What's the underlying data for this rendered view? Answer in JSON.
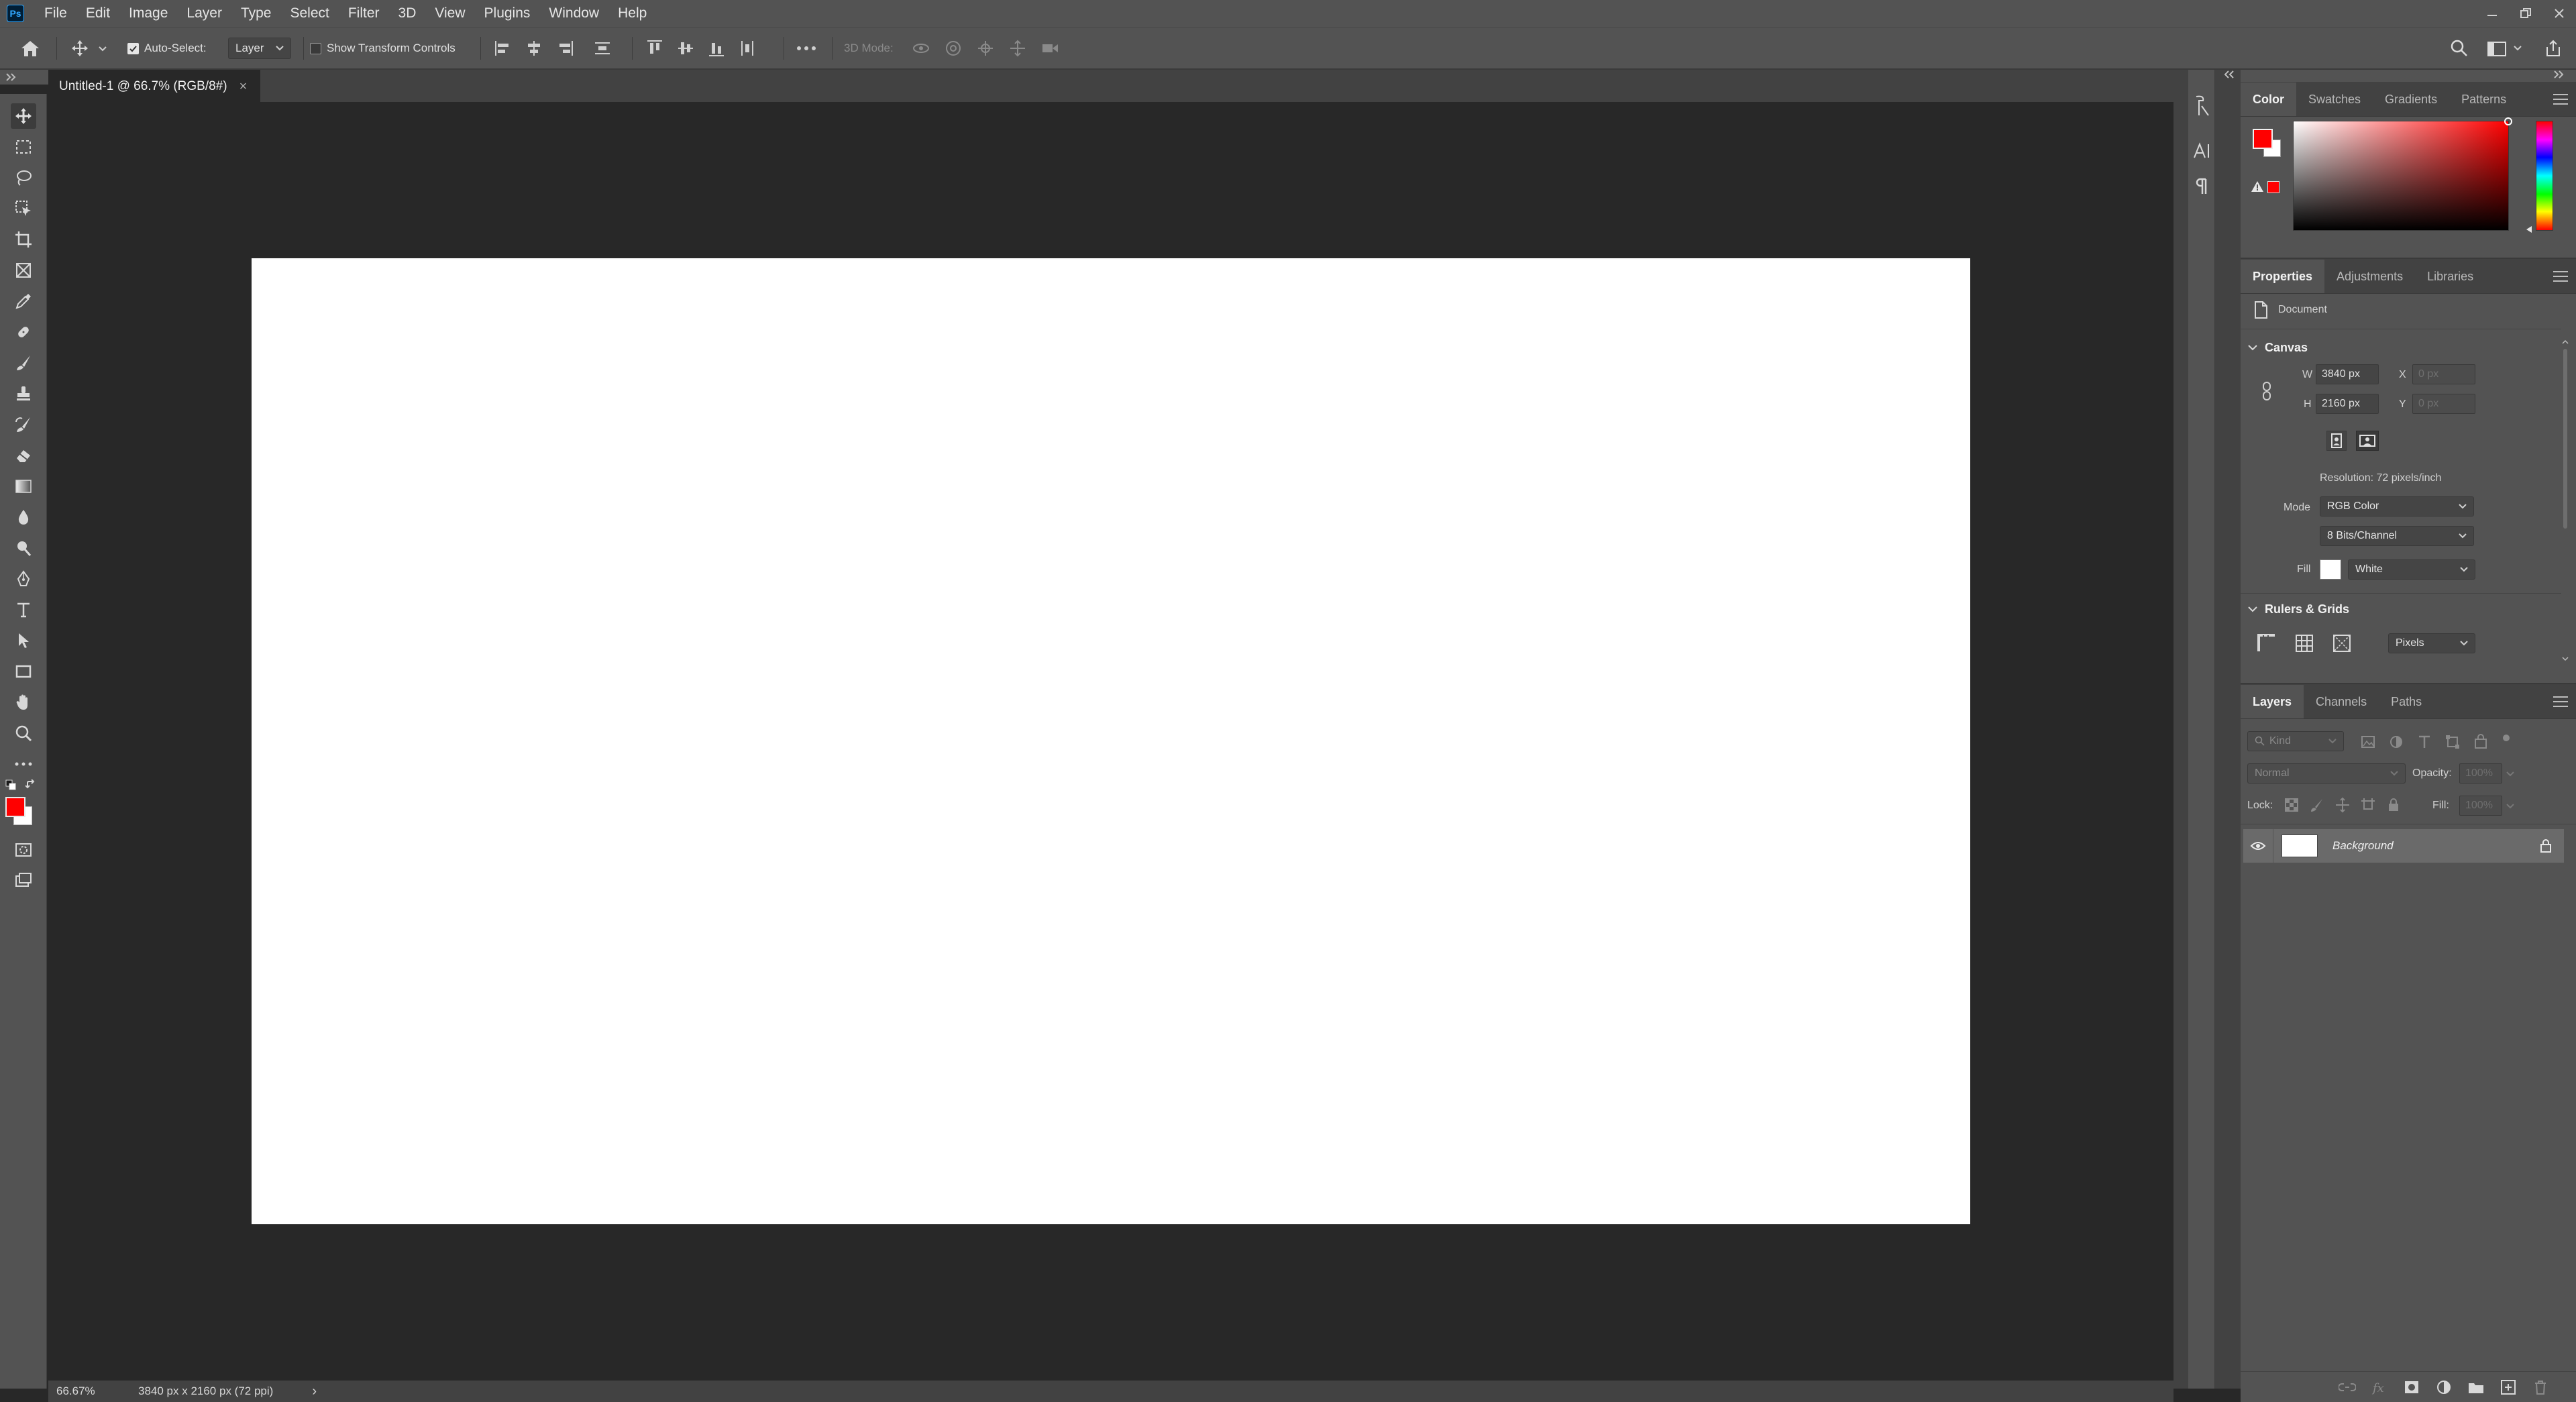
{
  "app": {
    "logo": "Ps",
    "menu": [
      "File",
      "Edit",
      "Image",
      "Layer",
      "Type",
      "Select",
      "Filter",
      "3D",
      "View",
      "Plugins",
      "Window",
      "Help"
    ]
  },
  "options_bar": {
    "auto_select_label": "Auto-Select:",
    "auto_select_checked": true,
    "auto_select_target": "Layer",
    "show_transform_label": "Show Transform Controls",
    "show_transform_checked": false,
    "three_d_mode_label": "3D Mode:"
  },
  "document_tab": {
    "title": "Untitled-1 @ 66.7% (RGB/8#)",
    "close_glyph": "×"
  },
  "colors": {
    "foreground": "#ff0000",
    "background": "#ffffff",
    "canvas_fill": "#ffffff",
    "ui_panel": "#535353",
    "ui_dark": "#282828"
  },
  "color_panel": {
    "tabs": [
      "Color",
      "Swatches",
      "Gradients",
      "Patterns"
    ],
    "active_tab": "Color"
  },
  "properties_panel": {
    "tabs": [
      "Properties",
      "Adjustments",
      "Libraries"
    ],
    "active_tab": "Properties",
    "kind_label": "Document",
    "canvas_section": "Canvas",
    "width_label": "W",
    "width_value": "3840 px",
    "height_label": "H",
    "height_value": "2160 px",
    "x_label": "X",
    "x_placeholder": "0 px",
    "y_label": "Y",
    "y_placeholder": "0 px",
    "resolution": "Resolution: 72 pixels/inch",
    "mode_label": "Mode",
    "mode_value": "RGB Color",
    "bits_value": "8 Bits/Channel",
    "fill_label": "Fill",
    "fill_value": "White",
    "rulers_section": "Rulers & Grids",
    "units_value": "Pixels"
  },
  "layers_panel": {
    "tabs": [
      "Layers",
      "Channels",
      "Paths"
    ],
    "active_tab": "Layers",
    "filter_placeholder": "Kind",
    "blend_mode": "Normal",
    "opacity_label": "Opacity:",
    "opacity_value": "100%",
    "lock_label": "Lock:",
    "fill_label": "Fill:",
    "fill_value": "100%",
    "layers": [
      {
        "name": "Background",
        "visible": true,
        "locked": true
      }
    ]
  },
  "status_bar": {
    "zoom": "66.67%",
    "doc_info": "3840 px x 2160 px (72 ppi)",
    "arrow": "›"
  }
}
